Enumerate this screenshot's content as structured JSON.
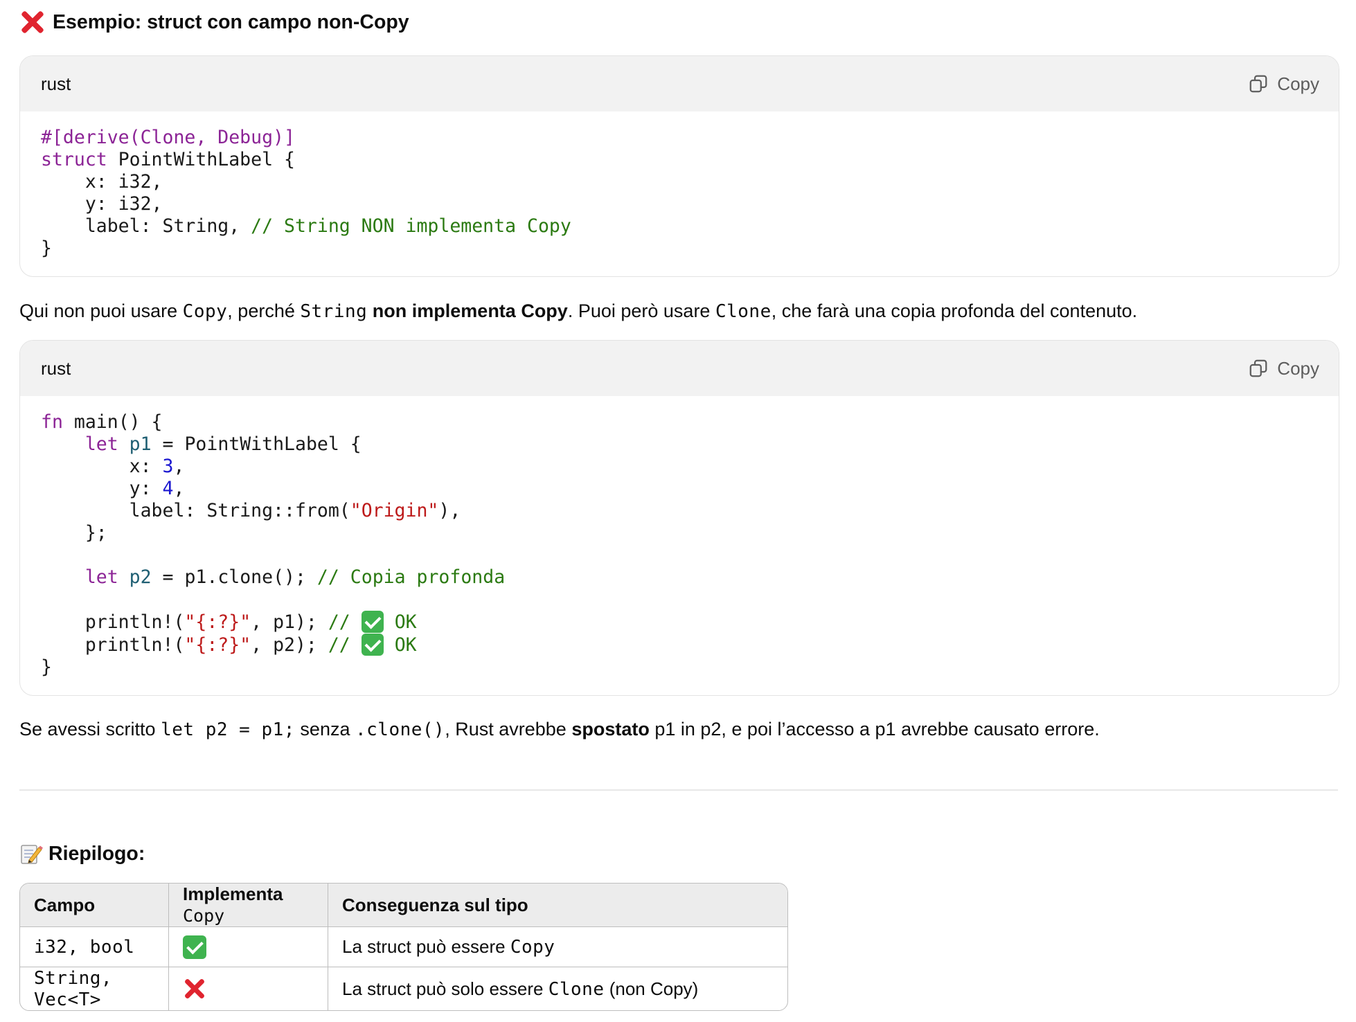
{
  "section1": {
    "heading": "Esempio: struct con campo non-Copy",
    "heading_icon": "cross-mark-icon"
  },
  "code1": {
    "language": "rust",
    "copy_label": "Copy",
    "lines": {
      "l1": "#[derive(Clone, Debug)]",
      "l2_kw": "struct",
      "l2_rest": " PointWithLabel {",
      "l3": "    x: i32,",
      "l4": "    y: i32,",
      "l5_code": "    label: String, ",
      "l5_comment": "// String NON implementa Copy",
      "l6": "}"
    }
  },
  "para1": {
    "t1": "Qui non puoi usare ",
    "c1": "Copy",
    "t2": ", perché ",
    "c2": "String",
    "t3": " ",
    "b1": "non implementa Copy",
    "t4": ". Puoi però usare ",
    "c3": "Clone",
    "t5": ", che farà una copia profonda del contenuto."
  },
  "code2": {
    "language": "rust",
    "copy_label": "Copy",
    "lines": {
      "fn": "fn",
      "main_sig": " main() {",
      "let": "let",
      "p1": "p1",
      "struct_open": " = PointWithLabel {",
      "x_label": "        x: ",
      "x_val": "3",
      "y_label": "        y: ",
      "y_val": "4",
      "label_start": "        label: String::from(",
      "label_str": "\"Origin\"",
      "label_end": "),",
      "struct_close": "    };",
      "p2": "p2",
      "clone_expr": " = p1.clone(); ",
      "clone_comment": "// Copia profonda",
      "println": "    println!(",
      "fmt_str": "\"{:?}\"",
      "arg1": ", p1); ",
      "arg2": ", p2); ",
      "comment_slashes": "//",
      "ok": "OK",
      "close": "}"
    }
  },
  "para2": {
    "t1": "Se avessi scritto ",
    "c1": "let p2 = p1;",
    "t2": " senza ",
    "c2": ".clone()",
    "t3": ", Rust avrebbe ",
    "b1": "spostato",
    "t4": " p1 in p2, e poi l’accesso a p1 avrebbe causato errore."
  },
  "summary": {
    "heading": "Riepilogo:",
    "heading_icon": "memo-icon",
    "headers": {
      "col1": "Campo",
      "col2_text": "Implementa ",
      "col2_code": "Copy",
      "col3": "Conseguenza sul tipo"
    },
    "rows": [
      {
        "campo": "i32, bool",
        "implementa_icon": "check-mark-icon",
        "conseguenza_text": "La struct può essere ",
        "conseguenza_code": "Copy",
        "conseguenza_suffix": ""
      },
      {
        "campo": "String, Vec<T>",
        "implementa_icon": "cross-mark-icon",
        "conseguenza_text": "La struct può solo essere ",
        "conseguenza_code": "Clone",
        "conseguenza_suffix": " (non Copy)"
      }
    ]
  }
}
